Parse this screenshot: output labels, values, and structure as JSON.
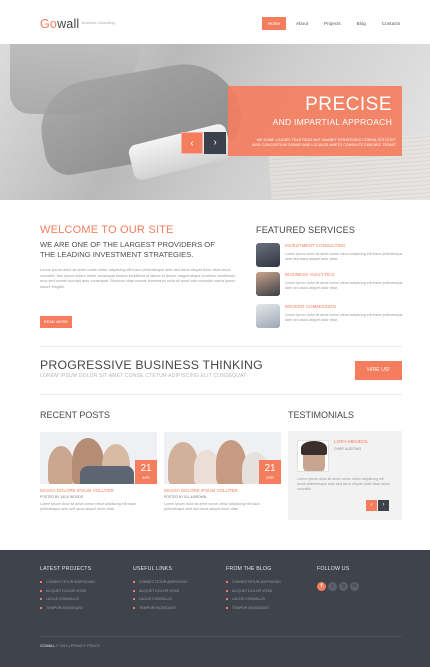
{
  "header": {
    "logo_text": "Gowall",
    "tagline": "Business Consulting",
    "nav": [
      "Home",
      "About",
      "Projects",
      "Blog",
      "Contacts"
    ],
    "nav_active": "Home"
  },
  "hero": {
    "title": "PRECISE",
    "subtitle": "AND IMPARTIAL APPROACH",
    "description": "WE SOME CAUSES TEAS READ BUT AMARET STRATEGIES CONSULTES DITET AVID CONCORTIUM DOMUS AND LOCALES AMETO CONSULTE DUM NEC TEDMIT",
    "prev_icon": "‹",
    "next_icon": "›"
  },
  "welcome": {
    "title": "WELCOME TO OUR SITE",
    "subtitle": "WE ARE ONE OF THE LARGEST PROVIDERS OF THE LEADING INVESTMENT STRATEGIES.",
    "text": "Lorem ipsum dolor sit amet conse ctetur adipiscing elit fusce pellentesque ante sed lacus aliquet dolor vitae lacus convallis. Nisi ipsum dolore lorem consequat tempor incididunt ut labore et dolore magna aliqua curabitur vestibulum eros sed laoreet suscipit ante consequat. Rhoncus vitae mauris fermentum nulla sit amet odio convallis varius ipsum dolore fringilla.",
    "button": "READ MORE"
  },
  "featured": {
    "title": "FEATURED SERVICES",
    "items": [
      {
        "name": "INVESTMENT CONSULTING",
        "text": "Lorem ipsum dolor sit amet conse ctetur adipiscing elit fusce pellentesque ante sed lacus aliquet dolor vitae."
      },
      {
        "name": "BUSINESS ANALYTICS",
        "text": "Lorem ipsum dolor sit amet conse ctetur adipiscing elit fusce pellentesque ante sed lacus aliquet dolor vitae."
      },
      {
        "name": "BROKER COMMISSION",
        "text": "Lorem ipsum dolor sit amet conse ctetur adipiscing elit fusce pellentesque ante sed lacus aliquet dolor vitae."
      }
    ]
  },
  "progressive": {
    "title": "PROGRESSIVE BUSINESS THINKING",
    "subtitle": "LOREM IPSUM DOLOR SIT AMET CONSE CTETUR ADIPISCING ELIT CONSEQUAT",
    "button": "HIRE US!"
  },
  "recent_posts": {
    "title": "RECENT POSTS",
    "posts": [
      {
        "day": "21",
        "month": "APR",
        "title": "MASSA DOLORE IPSUM VOLUTER",
        "by": "POSTED BY JACK WOODS",
        "text": "Lorem ipsum dolor sit amet conse ctetur adipiscing elit fusce pellentesque ante sed lacus aliquet dolor vitae."
      },
      {
        "day": "21",
        "month": "APR",
        "title": "MASSA DOLORE IPSUM VOLUTER",
        "by": "POSTED BY ELLA BROWN",
        "text": "Lorem ipsum dolor sit amet conse ctetur adipiscing elit fusce pellentesque ante sed lacus aliquet dolor vitae."
      }
    ]
  },
  "testimonials": {
    "title": "TESTIMONIALS",
    "name": "LORA MENDOL",
    "role": "CHIEF AUDITING",
    "text": "Lorem ipsum dolor sit amet conse ctetur adipiscing elit fusce pellentesque ante sed lacus aliquet dolor vitae lacus convallis.",
    "prev_icon": "‹",
    "next_icon": "›"
  },
  "footer": {
    "columns": [
      {
        "title": "LATEST PROJECTS",
        "items": [
          "CONSECTETUR ADIPISCING",
          "ALIQUET DOLOR VITAE",
          "LACUS CONVALLIS",
          "TEMPOR INCIDIDUNT"
        ]
      },
      {
        "title": "USEFUL LINKS",
        "items": [
          "CONSECTETUR ADIPISCING",
          "ALIQUET DOLOR VITAE",
          "LACUS CONVALLIS",
          "TEMPOR INCIDIDUNT"
        ]
      },
      {
        "title": "FROM THE BLOG",
        "items": [
          "CONSECTETUR ADIPISCING",
          "ALIQUET DOLOR VITAE",
          "LACUS CONVALLIS",
          "TEMPOR INCIDIDUNT"
        ]
      }
    ],
    "follow_title": "FOLLOW US",
    "social": [
      "f",
      "t",
      "g",
      "in"
    ],
    "copyright_brand": "GOWALL",
    "copyright_text": "© 2014 | PRIVACY POLICY"
  },
  "colors": {
    "accent": "#f47d5e",
    "dark": "#3e434c"
  }
}
